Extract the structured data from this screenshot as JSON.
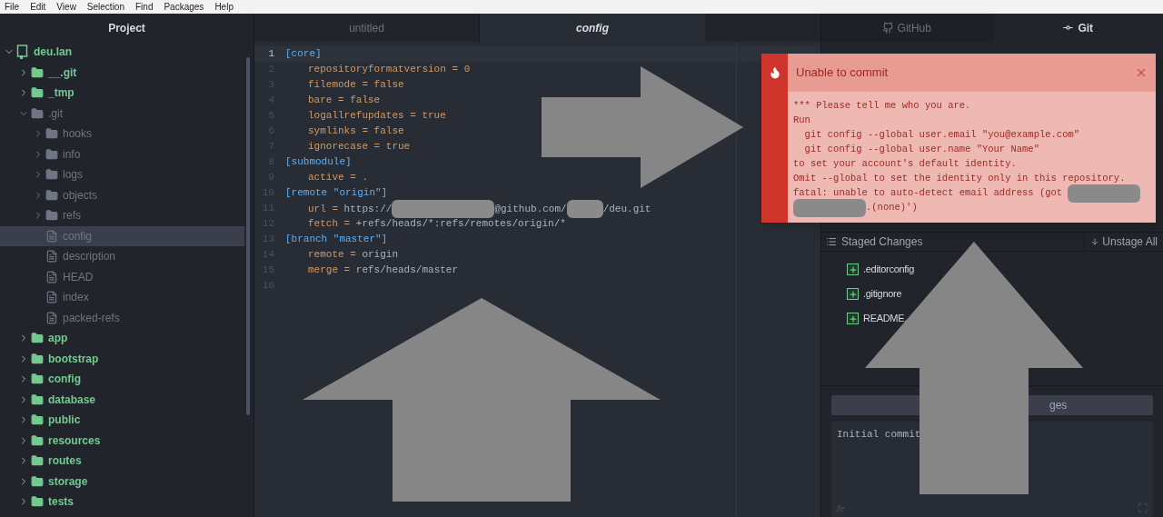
{
  "menu_bar": [
    "File",
    "Edit",
    "View",
    "Selection",
    "Find",
    "Packages",
    "Help"
  ],
  "tree_view": {
    "title": "Project",
    "items": [
      {
        "name": "deu.lan",
        "kind": "project",
        "ignored": false,
        "expanded": true,
        "selected": false,
        "children": [
          {
            "name": "__.git",
            "kind": "folder",
            "ignored": false,
            "expanded": false,
            "selected": false
          },
          {
            "name": "_tmp",
            "kind": "folder",
            "ignored": false,
            "expanded": false,
            "selected": false
          },
          {
            "name": ".git",
            "kind": "folder",
            "ignored": true,
            "expanded": true,
            "selected": false,
            "children": [
              {
                "name": "hooks",
                "kind": "folder",
                "ignored": true,
                "expanded": false,
                "selected": false
              },
              {
                "name": "info",
                "kind": "folder",
                "ignored": true,
                "expanded": false,
                "selected": false
              },
              {
                "name": "logs",
                "kind": "folder",
                "ignored": true,
                "expanded": false,
                "selected": false
              },
              {
                "name": "objects",
                "kind": "folder",
                "ignored": true,
                "expanded": false,
                "selected": false
              },
              {
                "name": "refs",
                "kind": "folder",
                "ignored": true,
                "expanded": false,
                "selected": false
              },
              {
                "name": "config",
                "kind": "file",
                "ignored": true,
                "selected": true
              },
              {
                "name": "description",
                "kind": "file",
                "ignored": true,
                "selected": false
              },
              {
                "name": "HEAD",
                "kind": "file",
                "ignored": true,
                "selected": false
              },
              {
                "name": "index",
                "kind": "file",
                "ignored": true,
                "selected": false
              },
              {
                "name": "packed-refs",
                "kind": "file",
                "ignored": true,
                "selected": false
              }
            ]
          },
          {
            "name": "app",
            "kind": "folder",
            "ignored": false,
            "expanded": false,
            "selected": false
          },
          {
            "name": "bootstrap",
            "kind": "folder",
            "ignored": false,
            "expanded": false,
            "selected": false
          },
          {
            "name": "config",
            "kind": "folder",
            "ignored": false,
            "expanded": false,
            "selected": false
          },
          {
            "name": "database",
            "kind": "folder",
            "ignored": false,
            "expanded": false,
            "selected": false
          },
          {
            "name": "public",
            "kind": "folder",
            "ignored": false,
            "expanded": false,
            "selected": false
          },
          {
            "name": "resources",
            "kind": "folder",
            "ignored": false,
            "expanded": false,
            "selected": false
          },
          {
            "name": "routes",
            "kind": "folder",
            "ignored": false,
            "expanded": false,
            "selected": false
          },
          {
            "name": "storage",
            "kind": "folder",
            "ignored": false,
            "expanded": false,
            "selected": false
          },
          {
            "name": "tests",
            "kind": "folder",
            "ignored": false,
            "expanded": false,
            "selected": false
          }
        ]
      }
    ]
  },
  "editor": {
    "tabs": [
      {
        "label": "untitled",
        "selected": false
      },
      {
        "label": "config",
        "selected": true
      }
    ],
    "lines": [
      {
        "number": "1",
        "indent": false,
        "tokens": [
          {
            "kind": "section",
            "text": "[core]"
          }
        ]
      },
      {
        "number": "2",
        "indent": true,
        "tokens": [
          {
            "kind": "key",
            "text": "repositoryformatversion = 0"
          }
        ]
      },
      {
        "number": "3",
        "indent": true,
        "tokens": [
          {
            "kind": "key",
            "text": "filemode = false"
          }
        ]
      },
      {
        "number": "4",
        "indent": true,
        "tokens": [
          {
            "kind": "key",
            "text": "bare = false"
          }
        ]
      },
      {
        "number": "5",
        "indent": true,
        "tokens": [
          {
            "kind": "key",
            "text": "logallrefupdates = true"
          }
        ]
      },
      {
        "number": "6",
        "indent": true,
        "tokens": [
          {
            "kind": "key",
            "text": "symlinks = false"
          }
        ]
      },
      {
        "number": "7",
        "indent": true,
        "tokens": [
          {
            "kind": "key",
            "text": "ignorecase = true"
          }
        ]
      },
      {
        "number": "8",
        "indent": false,
        "tokens": [
          {
            "kind": "section",
            "text": "[submodule]"
          }
        ]
      },
      {
        "number": "9",
        "indent": true,
        "tokens": [
          {
            "kind": "key",
            "text": "active = ."
          }
        ]
      },
      {
        "number": "10",
        "indent": false,
        "tokens": [
          {
            "kind": "section",
            "text": "[remote \"origin\"]"
          }
        ]
      },
      {
        "number": "11",
        "indent": true,
        "tokens": [
          {
            "kind": "key",
            "text": "url = "
          },
          {
            "kind": "text",
            "text": "https://"
          },
          {
            "kind": "redaction"
          },
          {
            "kind": "text",
            "text": "@github.com/"
          },
          {
            "kind": "redaction"
          },
          {
            "kind": "text",
            "text": "/deu.git"
          }
        ]
      },
      {
        "number": "12",
        "indent": true,
        "tokens": [
          {
            "kind": "key",
            "text": "fetch = "
          },
          {
            "kind": "text",
            "text": "+refs/heads/*:refs/remotes/origin/*"
          }
        ]
      },
      {
        "number": "13",
        "indent": false,
        "tokens": [
          {
            "kind": "section",
            "text": "[branch \"master\"]"
          }
        ]
      },
      {
        "number": "14",
        "indent": true,
        "tokens": [
          {
            "kind": "key",
            "text": "remote = "
          },
          {
            "kind": "text",
            "text": "origin"
          }
        ]
      },
      {
        "number": "15",
        "indent": true,
        "tokens": [
          {
            "kind": "key",
            "text": "merge = "
          },
          {
            "kind": "text",
            "text": "refs/heads/master"
          }
        ]
      },
      {
        "number": "16"
      }
    ]
  },
  "git_panel": {
    "tabs": [
      {
        "label": "GitHub",
        "selected": false
      },
      {
        "label": "Git",
        "selected": true
      }
    ],
    "staged": {
      "title": "Staged Changes",
      "action": "Unstage All",
      "files": [
        ".editorconfig",
        ".gitignore",
        "README."
      ]
    },
    "commit_button": "ges",
    "commit_message": "Initial commit"
  },
  "notification": {
    "title": "Unable to commit",
    "lines": [
      [
        {
          "kind": "text",
          "text": "*** Please tell me who you are."
        }
      ],
      [
        {
          "kind": "text",
          "text": "Run"
        }
      ],
      [
        {
          "kind": "text",
          "text": "  git config --global user.email \"you@example.com\""
        }
      ],
      [
        {
          "kind": "text",
          "text": "  git config --global user.name \"Your Name\""
        }
      ],
      [
        {
          "kind": "text",
          "text": "to set your account's default identity."
        }
      ],
      [
        {
          "kind": "text",
          "text": "Omit --global to set the identity only in this repository."
        }
      ],
      [
        {
          "kind": "text",
          "text": "fatal: unable to auto-detect email address (got "
        },
        {
          "kind": "redaction"
        }
      ],
      [
        {
          "kind": "redaction"
        },
        {
          "kind": "text",
          "text": ".(none)')"
        }
      ]
    ]
  }
}
